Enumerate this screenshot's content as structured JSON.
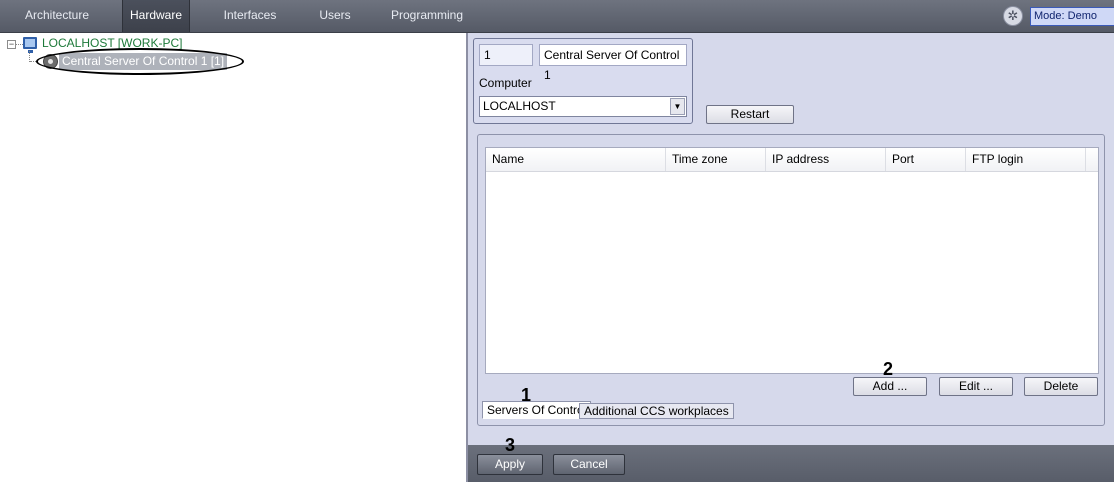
{
  "nav": {
    "tabs": [
      {
        "label": "Architecture"
      },
      {
        "label": "Hardware"
      },
      {
        "label": "Interfaces"
      },
      {
        "label": "Users"
      },
      {
        "label": "Programming"
      }
    ],
    "active_tab": "Hardware",
    "mode_label": "Mode: Demo"
  },
  "tree": {
    "root_label": "LOCALHOST [WORK-PC]",
    "child_label": "Central Server Of Control 1 [1]"
  },
  "settings": {
    "id_value": "1",
    "name_value": "Central Server Of Control 1",
    "computer_label": "Computer",
    "computer_value": "LOCALHOST",
    "restart_label": "Restart",
    "table": {
      "columns": [
        "Name",
        "Time zone",
        "IP address",
        "Port",
        "FTP login"
      ],
      "rows": []
    },
    "add_label": "Add ...",
    "edit_label": "Edit ...",
    "delete_label": "Delete",
    "tabs": [
      "Servers Of Control",
      "Additional CCS workplaces"
    ]
  },
  "annotations": {
    "step1": "1",
    "step2": "2",
    "step3": "3"
  },
  "footer": {
    "apply_label": "Apply",
    "cancel_label": "Cancel"
  },
  "colors": {
    "topbar": "#5f6470",
    "panel_bg": "#d6d9eb",
    "mode_box": "#cfd8f6",
    "tree_root_text": "#1e7a3a",
    "selected_node": "#aeb2ba"
  }
}
